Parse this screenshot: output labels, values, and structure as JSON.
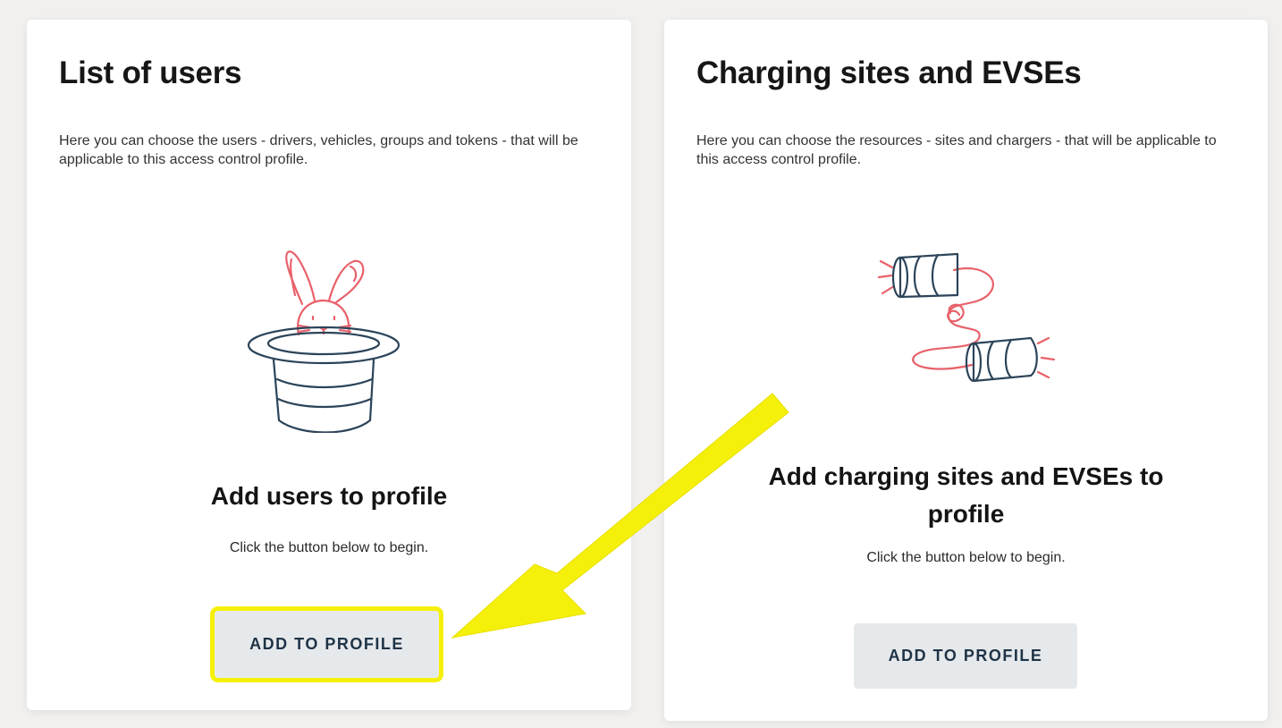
{
  "users_card": {
    "title": "List of users",
    "description": "Here you can choose the users - drivers, vehicles, groups and tokens - that will be applicable to this access control profile.",
    "empty_title": "Add users to profile",
    "empty_subtitle": "Click the button below to begin.",
    "button_label": "ADD TO PROFILE",
    "illustration": "rabbit-in-hat-icon"
  },
  "sites_card": {
    "title": "Charging sites and EVSEs",
    "description": "Here you can choose the resources - sites and chargers - that will be applicable to this access control profile.",
    "empty_title": "Add charging sites and EVSEs to profile",
    "empty_subtitle": "Click the button below to begin.",
    "button_label": "ADD TO PROFILE",
    "illustration": "tin-can-phone-icon"
  },
  "colors": {
    "highlight": "#f5f00a",
    "illustration_red": "#e8616a",
    "illustration_navy": "#2c4459",
    "button_bg": "#e6e9ec"
  }
}
